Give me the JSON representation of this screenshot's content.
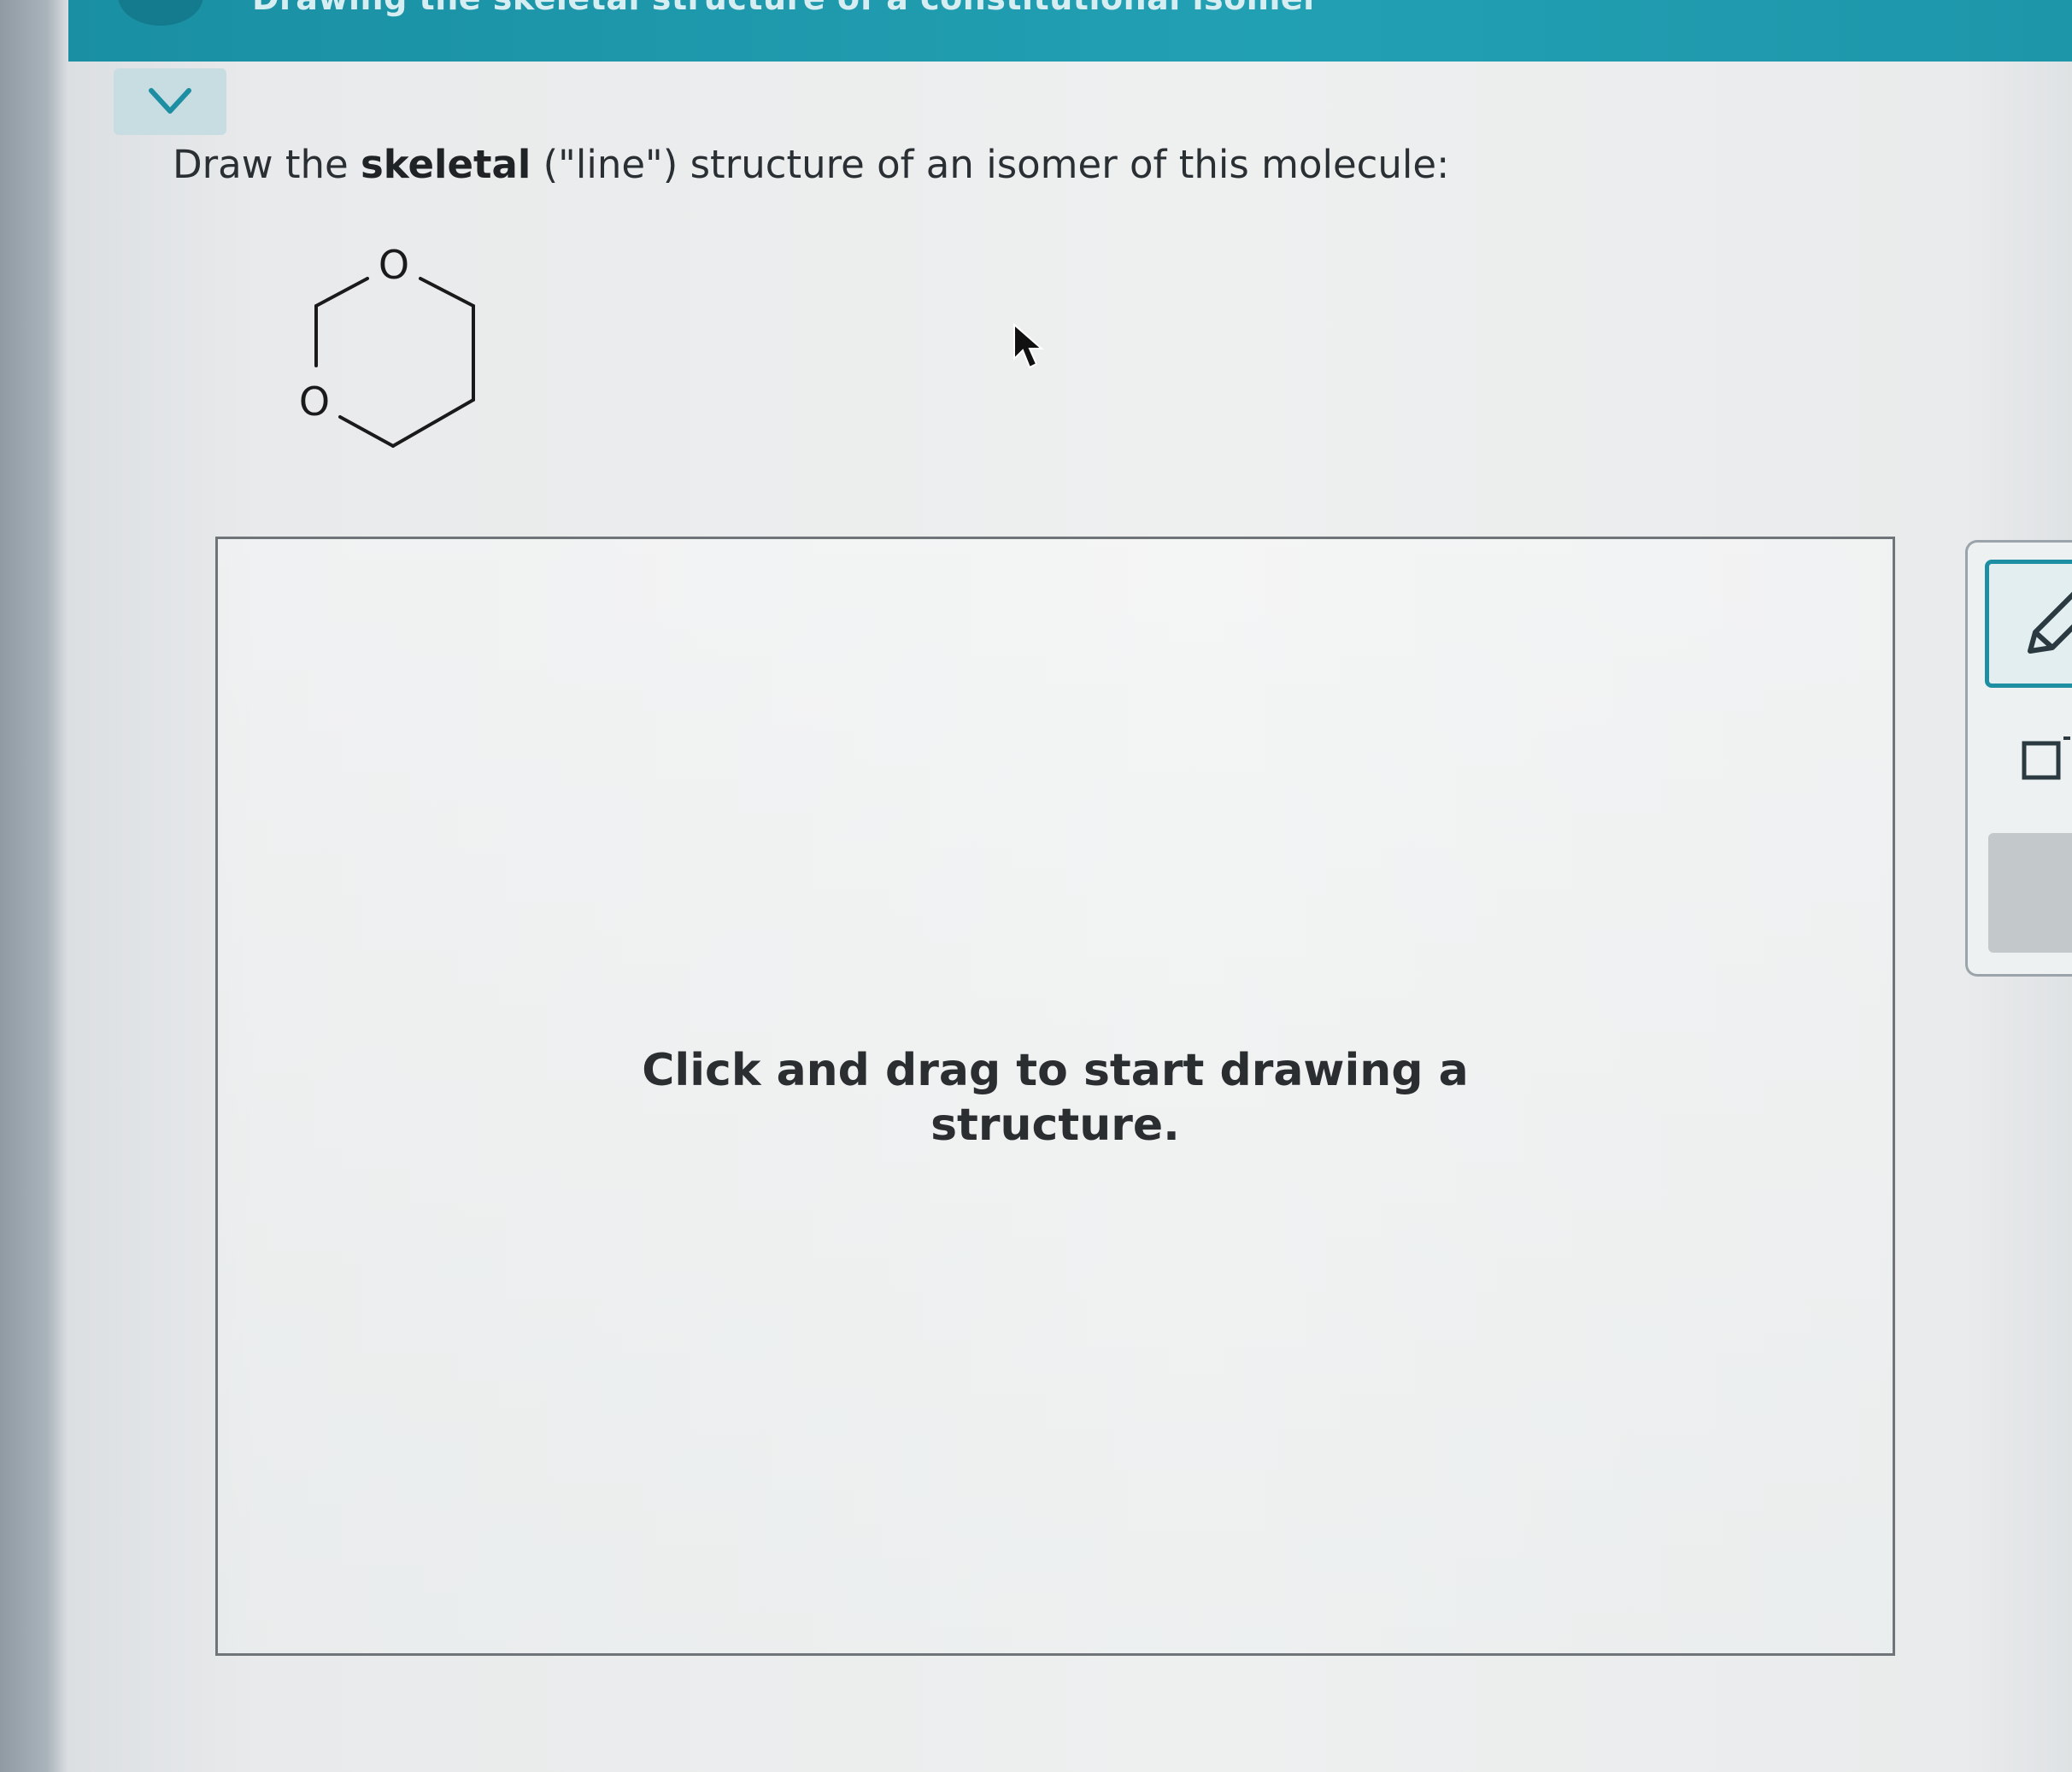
{
  "header": {
    "title": "Drawing the skeletal structure of a constitutional isomer"
  },
  "question": {
    "prefix": "Draw the ",
    "bold_word": "skeletal",
    "suffix": " (\"line\") structure of an isomer of this molecule:"
  },
  "molecule": {
    "atom_label_top": "O",
    "atom_label_left": "O"
  },
  "canvas": {
    "hint_line1": "Click and drag to start drawing a",
    "hint_line2": "structure."
  },
  "toolbar": {
    "tools": [
      "pencil-icon",
      "square-icon"
    ]
  },
  "colors": {
    "accent": "#1e8ea2",
    "header_band": "#22a0b3",
    "text": "#2a2f33"
  }
}
